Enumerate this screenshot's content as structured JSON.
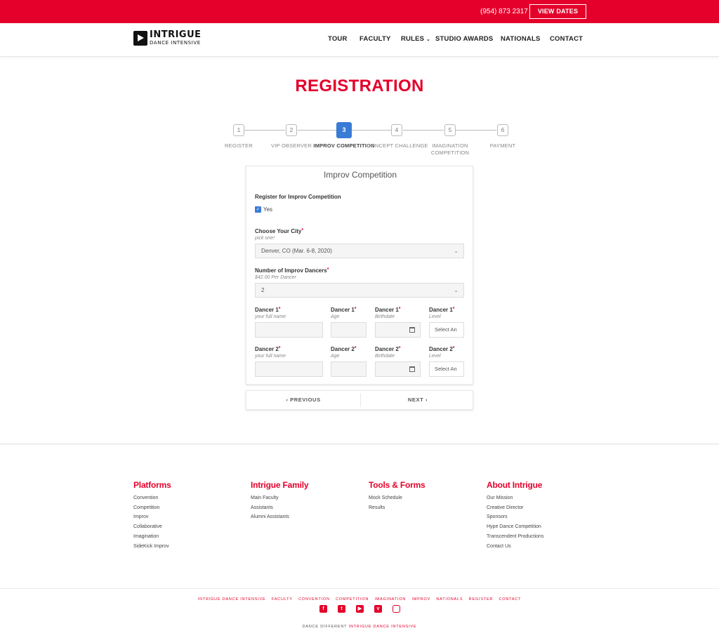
{
  "topbar": {
    "phone": "(954) 873 2317",
    "view_dates": "VIEW DATES"
  },
  "logo": {
    "line1": "INTRIGUE",
    "line2": "DANCE INTENSIVE"
  },
  "nav": {
    "items": [
      "TOUR",
      "FACULTY",
      "RULES",
      "STUDIO AWARDS",
      "NATIONALS",
      "CONTACT"
    ]
  },
  "page": {
    "title": "REGISTRATION"
  },
  "stepper": {
    "current_step": 3,
    "steps": [
      {
        "number": "1",
        "label": "REGISTER"
      },
      {
        "number": "2",
        "label": "VIP OBSERVER"
      },
      {
        "number": "3",
        "label": "IMPROV COMPETITION"
      },
      {
        "number": "4",
        "label": "CONCEPT CHALLENGE"
      },
      {
        "number": "5",
        "label": "IMAGINATION COMPETITION"
      },
      {
        "number": "6",
        "label": "PAYMENT"
      }
    ]
  },
  "form": {
    "title": "Improv Competition",
    "register_label": "Register for Improv Competition",
    "register_option": "Yes",
    "register_checked": true,
    "city_label": "Choose Your City",
    "city_hint": "pick one!",
    "city_value": "Denver, CO (Mar. 6-8, 2020)",
    "dancers_label": "Number of Improv Dancers",
    "dancers_hint": "$42.00 Per Dancer",
    "dancers_value": "2",
    "dancers": [
      {
        "name_label": "Dancer 1",
        "name_hint": "your full name",
        "name_value": "",
        "age_label": "Dancer 1",
        "age_hint": "Age",
        "age_value": "",
        "birth_label": "Dancer 1",
        "birth_hint": "Birthdate",
        "birth_value": "",
        "level_label": "Dancer 1",
        "level_hint": "Level",
        "level_value": "Select An"
      },
      {
        "name_label": "Dancer 2",
        "name_hint": "your full name",
        "name_value": "",
        "age_label": "Dancer 2",
        "age_hint": "Age",
        "age_value": "",
        "birth_label": "Dancer 2",
        "birth_hint": "Birthdate",
        "birth_value": "",
        "level_label": "Dancer 2",
        "level_hint": "Level",
        "level_value": "Select An"
      }
    ]
  },
  "buttons": {
    "previous": "‹ PREVIOUS",
    "next": "NEXT ›"
  },
  "footer": {
    "columns": [
      {
        "title": "Platforms",
        "links": [
          "Convention",
          "Competition",
          "Improv",
          "Collaborative",
          "Imagination",
          "SideKick Improv"
        ]
      },
      {
        "title": "Intrigue Family",
        "links": [
          "Main Faculty",
          "Assistants",
          "Alumni Assistants"
        ]
      },
      {
        "title": "Tools & Forms",
        "links": [
          "Mock Schedule",
          "Results"
        ]
      },
      {
        "title": "About Intrigue",
        "links": [
          "Our Mission",
          "Creative Director",
          "Sponsors",
          "Hype Dance Competition",
          "Transcendent Productions",
          "Contact Us"
        ]
      }
    ],
    "bottom_links": [
      "INTRIGUE DANCE INTENSIVE",
      "FACULTY",
      "CONVENTION",
      "COMPETITION",
      "IMAGINATION",
      "IMPROV",
      "NATIONALS",
      "REGISTER",
      "CONTACT"
    ],
    "social": [
      "facebook-icon",
      "twitter-icon",
      "youtube-icon",
      "vimeo-icon",
      "instagram-icon"
    ],
    "tagline_prefix": "DANCE DIFFERENT",
    "tagline_brand": "INTRIGUE DANCE INTENSIVE"
  },
  "colors": {
    "brand_red": "#e4002b",
    "active_step_blue": "#3a7bd5"
  }
}
